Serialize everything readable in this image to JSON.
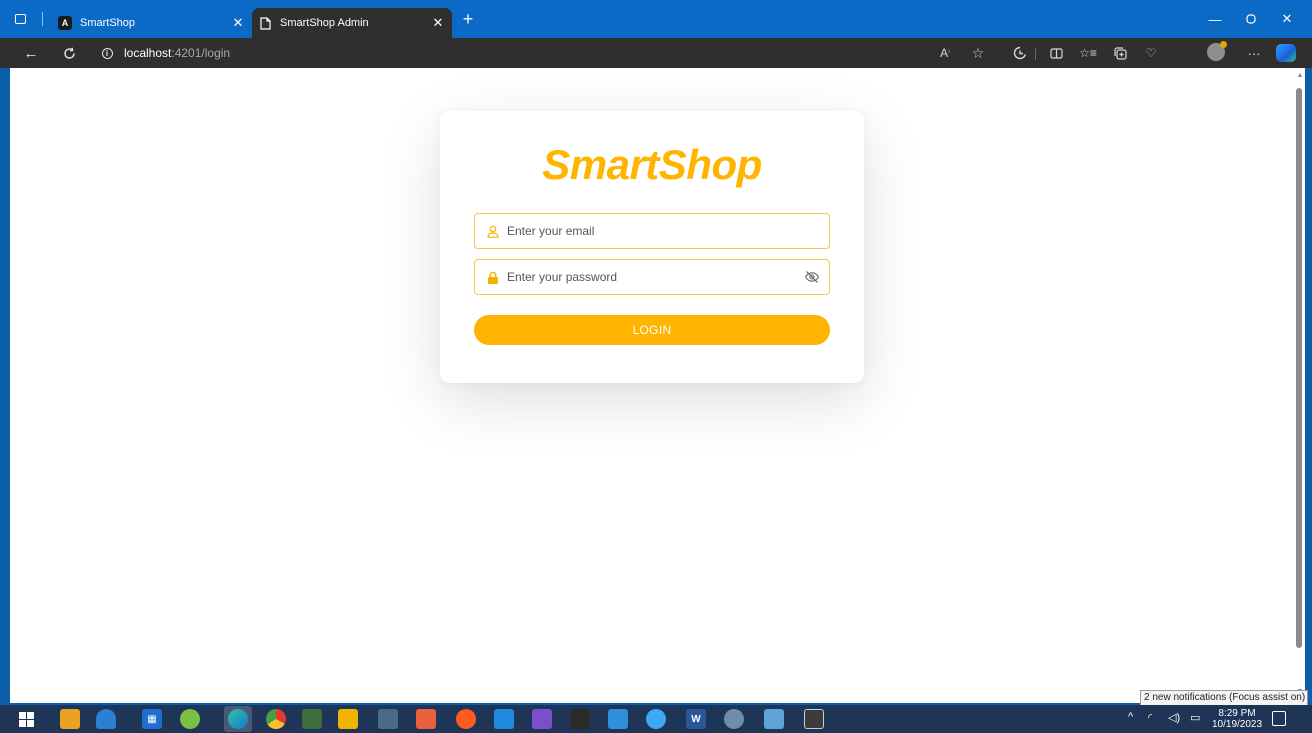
{
  "browser": {
    "tabs": [
      {
        "title": "SmartShop",
        "favicon": "angular-icon",
        "favicon_letter": "A",
        "active": false
      },
      {
        "title": "SmartShop Admin",
        "favicon": "page-icon",
        "active": true
      }
    ],
    "address": {
      "host": "localhost",
      "rest": ":4201/login"
    }
  },
  "login": {
    "logo": "SmartShop",
    "email_placeholder": "Enter your email",
    "password_placeholder": "Enter your password",
    "button_label": "LOGIN",
    "accent_color": "#ffb400"
  },
  "notification": {
    "text": "2 new notifications (Focus assist on)"
  },
  "taskbar": {
    "time": "8:29 PM",
    "date": "10/19/2023"
  }
}
